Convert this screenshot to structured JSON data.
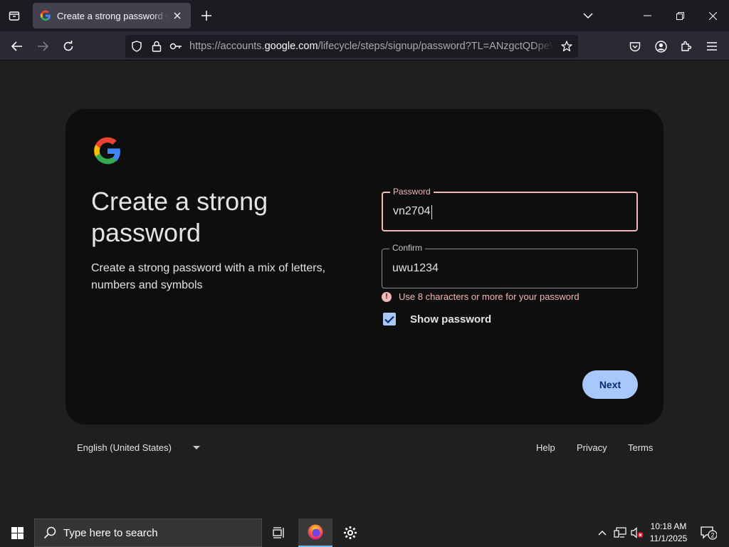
{
  "browser": {
    "tab": {
      "title": "Create a strong password Create a strong password"
    },
    "url": {
      "prefix": "https://accounts.",
      "domain": "google.com",
      "path": "/lifecycle/steps/signup/password?TL=ANzgctQDpeWpdx"
    }
  },
  "page": {
    "heading": "Create a strong password",
    "subtext": "Create a strong password with a mix of letters, numbers and symbols",
    "password": {
      "label": "Password",
      "value": "vn2704"
    },
    "confirm": {
      "label": "Confirm",
      "value": "uwu1234"
    },
    "error": {
      "icon": "!",
      "text": "Use 8 characters or more for your password"
    },
    "show_password": {
      "label": "Show password",
      "checked": true
    },
    "next_label": "Next"
  },
  "footer": {
    "language": "English (United States)",
    "help": "Help",
    "privacy": "Privacy",
    "terms": "Terms"
  },
  "taskbar": {
    "search_placeholder": "Type here to search",
    "time": "10:18 AM",
    "date": "11/1/2025",
    "notification_count": "2"
  },
  "colors": {
    "error": "#f2b8b5",
    "primary": "#a8c7fa",
    "card": "#0e0e0e",
    "page": "#1f1f1f"
  }
}
